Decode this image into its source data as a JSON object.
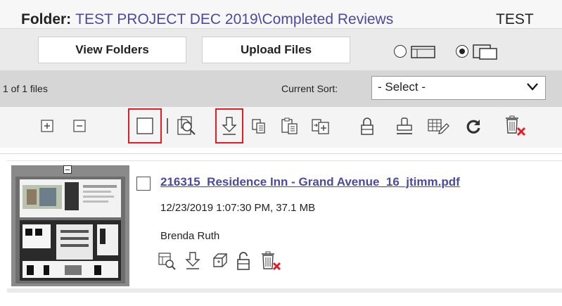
{
  "folder": {
    "label": "Folder:",
    "path": "TEST PROJECT DEC 2019\\Completed Reviews",
    "right_text": "TEST"
  },
  "buttons": {
    "view_folders": "View Folders",
    "upload_files": "Upload Files"
  },
  "view_mode": {
    "selected": "thumbnail"
  },
  "sort": {
    "file_count": "1 of 1 files",
    "label": "Current Sort:",
    "selected": "- Select -"
  },
  "toolbar": {
    "icons": [
      "expand-all-icon",
      "collapse-all-icon",
      "select-all-checkbox",
      "preview-icon",
      "download-icon",
      "copy-icon",
      "paste-icon",
      "move-icon",
      "lock-icon",
      "stamp-icon",
      "edit-icon",
      "refresh-icon",
      "delete-icon"
    ],
    "highlighted": [
      "select-all-checkbox",
      "download-icon"
    ]
  },
  "file": {
    "name": "216315_Residence Inn - Grand Avenue_16_jtimm.pdf",
    "meta": "12/23/2019 1:07:30 PM, 37.1 MB",
    "author": "Brenda Ruth",
    "actions": [
      "preview-icon",
      "download-icon",
      "copy-icon",
      "lock-icon",
      "delete-icon"
    ]
  },
  "colors": {
    "link": "#4a4aa0",
    "highlight": "#e51c23",
    "delete_x": "#e51c23"
  }
}
